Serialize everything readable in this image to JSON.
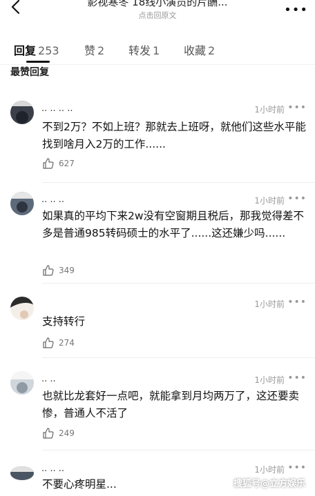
{
  "header": {
    "title": "影视寒冬 18线小演员的片酬...",
    "subtitle": "点击回原文"
  },
  "tabs": [
    {
      "label": "回复",
      "count": "253",
      "active": true
    },
    {
      "label": "赞",
      "count": "2",
      "active": false
    },
    {
      "label": "转发",
      "count": "1",
      "active": false
    },
    {
      "label": "收藏",
      "count": "2",
      "active": false
    }
  ],
  "section_title": "最赞回复",
  "comments": [
    {
      "username": "·· ·· ·· ··",
      "time": "1小时前",
      "text": "不到2万？不如上班？那就去上班呀，就他们这些水平能找到啥月入2万的工作......",
      "likes": "627"
    },
    {
      "username": "·· ·· ··",
      "time": "1小时前",
      "text": "如果真的平均下来2w没有空窗期且税后，那我觉得差不多是普通985转码硕士的水平了......这还嫌少吗......",
      "likes": "349"
    },
    {
      "username": "",
      "time": "1小时前",
      "text": "支持转行",
      "likes": "274"
    },
    {
      "username": "·· ··",
      "time": "1小时前",
      "text": "也就比龙套好一点吧，就能拿到月均两万了，这还要卖惨，普通人不活了",
      "likes": "249"
    },
    {
      "username": "·· ·· ··",
      "time": "1小时前",
      "text": "不要心疼明星...",
      "likes": ""
    }
  ],
  "watermark": "搜狐号@立方娱乐",
  "colors": {
    "text": "#111111",
    "muted": "#999999",
    "divider": "#ededed"
  },
  "icons": {
    "back": "chevron-left-icon",
    "more": "more-dots-icon",
    "like": "thumbs-up-icon"
  }
}
